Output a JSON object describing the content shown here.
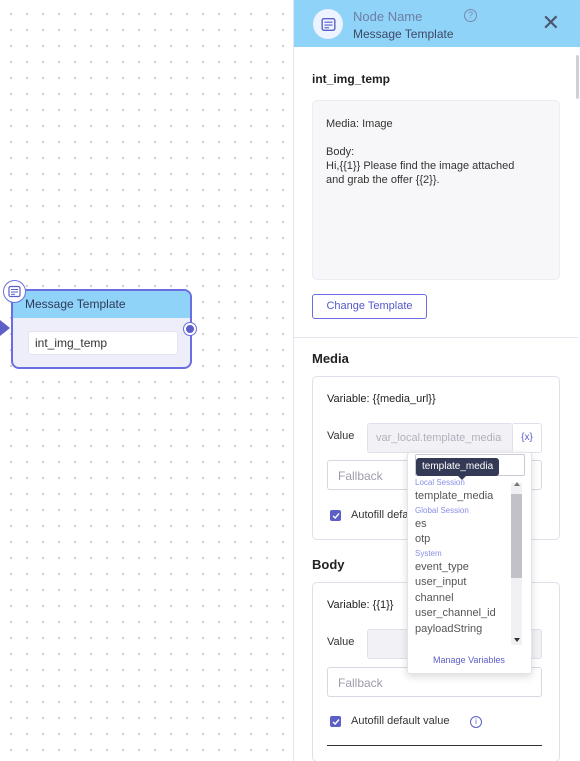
{
  "canvas": {
    "node": {
      "title": "Message Template",
      "field_value": "int_img_temp"
    }
  },
  "panel": {
    "header": {
      "title": "Node Name",
      "subtitle": "Message Template",
      "help_glyph": "?",
      "close_glyph": "✕"
    },
    "template_name": "int_img_temp",
    "preview": {
      "media_label": "Media:",
      "media_value": "Image",
      "body_label": "Body:",
      "body_line1": "Hi,{{1}} Please find the image attached",
      "body_line2": "and grab the offer {{2}}."
    },
    "change_template_label": "Change Template",
    "media_section": {
      "title": "Media",
      "variable_line": "Variable: {{media_url}}",
      "value_label": "Value",
      "value_input": "var_local.template_media",
      "var_button": "{x}",
      "fallback_placeholder": "Fallback",
      "autofill_label": "Autofill default value"
    },
    "body_section": {
      "title": "Body",
      "variable_line": "Variable: {{1}}",
      "value_label": "Value",
      "fallback_placeholder": "Fallback",
      "autofill_label": "Autofill default value",
      "info_glyph": "i"
    }
  },
  "dropdown": {
    "search_tooltip": "template_media",
    "groups": [
      {
        "label": "Local Session",
        "items": [
          "template_media"
        ]
      },
      {
        "label": "Global Session",
        "items": [
          "es",
          "otp"
        ]
      },
      {
        "label": "System",
        "items": [
          "event_type",
          "user_input",
          "channel",
          "user_channel_id",
          "payloadString"
        ]
      }
    ],
    "manage_label": "Manage Variables"
  },
  "icons": [
    "message-template-icon",
    "help-icon",
    "close-icon",
    "checkbox-checked-icon",
    "info-icon",
    "scroll-up-icon",
    "scroll-down-icon"
  ],
  "colors": {
    "accent": "#5b5fc7",
    "header_bg": "#8fd3f9",
    "node_bg": "#eeeefb"
  }
}
